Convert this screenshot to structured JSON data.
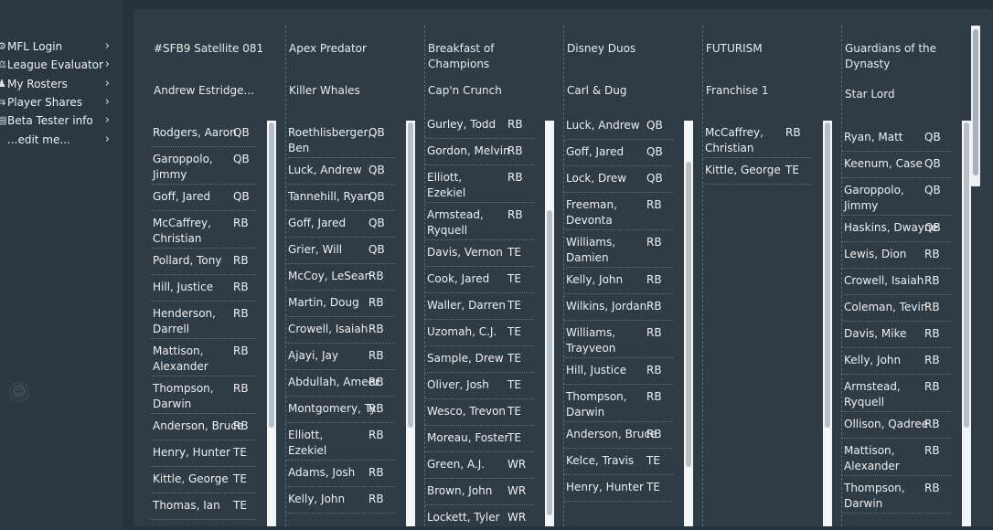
{
  "sidebar": {
    "items": [
      {
        "label": "MFL Login",
        "icon": "gear-icon",
        "glyph": "⚙",
        "chevron": "›"
      },
      {
        "label": "League Evaluator",
        "icon": "scale-icon",
        "glyph": "⚖",
        "chevron": "›"
      },
      {
        "label": "My Rosters",
        "icon": "user-icon",
        "glyph": "♟",
        "chevron": "›"
      },
      {
        "label": "Player Shares",
        "icon": "share-icon",
        "glyph": "⇆",
        "chevron": "›"
      },
      {
        "label": "Beta Tester info",
        "icon": "document-icon",
        "glyph": "▤",
        "chevron": "›"
      },
      {
        "label": "...edit me...",
        "icon": "",
        "glyph": "",
        "chevron": "›"
      }
    ],
    "emoji_glyph": "☺"
  },
  "teams": [
    {
      "name": "#SFB9 Satellite 081",
      "owner": "Andrew Estridge...",
      "players": [
        {
          "name": "Rodgers, Aaron",
          "pos": "QB"
        },
        {
          "name": "Garoppolo, Jimmy",
          "pos": "QB"
        },
        {
          "name": "Goff, Jared",
          "pos": "QB"
        },
        {
          "name": "McCaffrey, Christian",
          "pos": "RB"
        },
        {
          "name": "Pollard, Tony",
          "pos": "RB"
        },
        {
          "name": "Hill, Justice",
          "pos": "RB"
        },
        {
          "name": "Henderson, Darrell",
          "pos": "RB"
        },
        {
          "name": "Mattison, Alexander",
          "pos": "RB"
        },
        {
          "name": "Thompson, Darwin",
          "pos": "RB"
        },
        {
          "name": "Anderson, Bruce",
          "pos": "RB"
        },
        {
          "name": "Henry, Hunter",
          "pos": "TE"
        },
        {
          "name": "Kittle, George",
          "pos": "TE"
        },
        {
          "name": "Thomas, Ian",
          "pos": "TE"
        }
      ],
      "scroll_fraction": 0.0
    },
    {
      "name": "Apex Predator",
      "owner": "Killer Whales",
      "players": [
        {
          "name": "Roethlisberger, Ben",
          "pos": "QB"
        },
        {
          "name": "Luck, Andrew",
          "pos": "QB"
        },
        {
          "name": "Tannehill, Ryan",
          "pos": "QB"
        },
        {
          "name": "Goff, Jared",
          "pos": "QB"
        },
        {
          "name": "Grier, Will",
          "pos": "QB"
        },
        {
          "name": "McCoy, LeSean",
          "pos": "RB"
        },
        {
          "name": "Martin, Doug",
          "pos": "RB"
        },
        {
          "name": "Crowell, Isaiah",
          "pos": "RB"
        },
        {
          "name": "Ajayi, Jay",
          "pos": "RB"
        },
        {
          "name": "Abdullah, Ameer",
          "pos": "RB"
        },
        {
          "name": "Montgomery, Ty",
          "pos": "RB"
        },
        {
          "name": "Elliott, Ezekiel",
          "pos": "RB"
        },
        {
          "name": "Adams, Josh",
          "pos": "RB"
        },
        {
          "name": "Kelly, John",
          "pos": "RB"
        }
      ],
      "scroll_fraction": 0.0
    },
    {
      "name": "Breakfast of Champions",
      "owner": "Cap'n Crunch",
      "players": [
        {
          "name": "Gurley, Todd",
          "pos": "RB"
        },
        {
          "name": "Gordon, Melvin",
          "pos": "RB"
        },
        {
          "name": "Elliott, Ezekiel",
          "pos": "RB"
        },
        {
          "name": "Armstead, Ryquell",
          "pos": "RB"
        },
        {
          "name": "Davis, Vernon",
          "pos": "TE"
        },
        {
          "name": "Cook, Jared",
          "pos": "TE"
        },
        {
          "name": "Waller, Darren",
          "pos": "TE"
        },
        {
          "name": "Uzomah, C.J.",
          "pos": "TE"
        },
        {
          "name": "Sample, Drew",
          "pos": "TE"
        },
        {
          "name": "Oliver, Josh",
          "pos": "TE"
        },
        {
          "name": "Wesco, Trevon",
          "pos": "TE"
        },
        {
          "name": "Moreau, Foster",
          "pos": "TE"
        },
        {
          "name": "Green, A.J.",
          "pos": "WR"
        },
        {
          "name": "Brown, John",
          "pos": "WR"
        },
        {
          "name": "Lockett, Tyler",
          "pos": "WR"
        }
      ],
      "scroll_fraction": 0.9
    },
    {
      "name": "Disney Duos",
      "owner": "Carl & Dug",
      "players": [
        {
          "name": "Luck, Andrew",
          "pos": "QB"
        },
        {
          "name": "Goff, Jared",
          "pos": "QB"
        },
        {
          "name": "Lock, Drew",
          "pos": "QB"
        },
        {
          "name": "Freeman, Devonta",
          "pos": "RB"
        },
        {
          "name": "Williams, Damien",
          "pos": "RB"
        },
        {
          "name": "Kelly, John",
          "pos": "RB"
        },
        {
          "name": "Wilkins, Jordan",
          "pos": "RB"
        },
        {
          "name": "Williams, Trayveon",
          "pos": "RB"
        },
        {
          "name": "Hill, Justice",
          "pos": "RB"
        },
        {
          "name": "Thompson, Darwin",
          "pos": "RB"
        },
        {
          "name": "Anderson, Bruce",
          "pos": "RB"
        },
        {
          "name": "Kelce, Travis",
          "pos": "TE"
        },
        {
          "name": "Henry, Hunter",
          "pos": "TE"
        }
      ],
      "scroll_fraction": 0.4
    },
    {
      "name": "FUTURISM",
      "owner": "Franchise 1",
      "players": [
        {
          "name": "McCaffrey, Christian",
          "pos": "RB"
        },
        {
          "name": "Kittle, George",
          "pos": "TE"
        }
      ],
      "scroll_fraction": 0.0
    },
    {
      "name": "Guardians of the Dynasty",
      "owner": "Star Lord",
      "players": [
        {
          "name": "Ryan, Matt",
          "pos": "QB"
        },
        {
          "name": "Keenum, Case",
          "pos": "QB"
        },
        {
          "name": "Garoppolo, Jimmy",
          "pos": "QB"
        },
        {
          "name": "Haskins, Dwayne",
          "pos": "QB"
        },
        {
          "name": "Lewis, Dion",
          "pos": "RB"
        },
        {
          "name": "Crowell, Isaiah",
          "pos": "RB"
        },
        {
          "name": "Coleman, Tevin",
          "pos": "RB"
        },
        {
          "name": "Davis, Mike",
          "pos": "RB"
        },
        {
          "name": "Kelly, John",
          "pos": "RB"
        },
        {
          "name": "Armstead, Ryquell",
          "pos": "RB"
        },
        {
          "name": "Ollison, Qadree",
          "pos": "RB"
        },
        {
          "name": "Mattison, Alexander",
          "pos": "RB"
        },
        {
          "name": "Thompson, Darwin",
          "pos": "RB"
        }
      ],
      "scroll_fraction": 0.0
    }
  ]
}
